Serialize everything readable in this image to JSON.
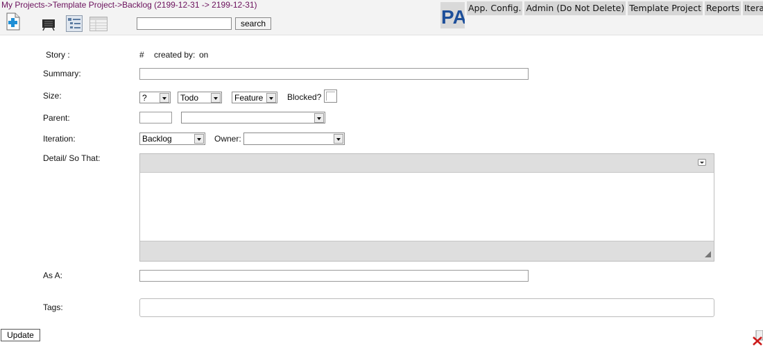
{
  "breadcrumb": {
    "my_projects": "My Projects",
    "sep1": "->",
    "project": "Template Project",
    "sep2": "->",
    "current": "Backlog (2199-12-31 -> 2199-12-31)"
  },
  "toolbar": {
    "search_value": "",
    "search_label": "search",
    "icons": [
      "add-story-icon",
      "storyboard-icon",
      "tree-view-icon",
      "table-view-icon"
    ]
  },
  "logo": {
    "text": "PA"
  },
  "topnav": [
    "App. Config.",
    "Admin (Do Not Delete)",
    "Template Project",
    "Reports",
    "Iterations"
  ],
  "form": {
    "story_label": "Story :",
    "story_number_prefix": "#",
    "created_by_label": "created by:",
    "on_label": "on",
    "summary_label": "Summary:",
    "summary_value": "",
    "size_label": "Size:",
    "size_value": "?",
    "status_value": "Todo",
    "type_value": "Feature",
    "blocked_label": "Blocked?",
    "blocked_checked": false,
    "parent_label": "Parent:",
    "parent_id_value": "",
    "parent_select_value": "",
    "iteration_label": "Iteration:",
    "iteration_value": "Backlog",
    "owner_label": "Owner:",
    "owner_value": "",
    "detail_label": "Detail/ So That:",
    "detail_value": "",
    "as_a_label": "As A:",
    "as_a_value": "",
    "tags_label": "Tags:",
    "tags_value": ""
  },
  "actions": {
    "update_label": "Update"
  },
  "colors": {
    "breadcrumb_link": "#6a0f5b",
    "logo_blue": "#1d4f9a",
    "nav_bg": "#d6d6d6"
  }
}
